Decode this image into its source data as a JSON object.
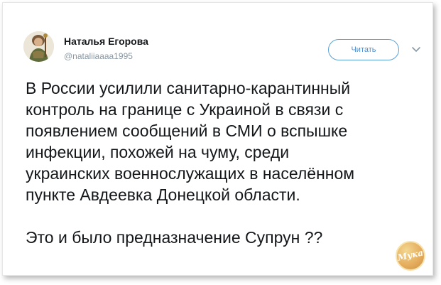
{
  "tweet": {
    "author": {
      "name": "Наталья Егорова",
      "handle": "@nataliiaaaa1995"
    },
    "follow_label": "Читать",
    "more_icon": "chevron-down-icon",
    "lines": [
      "В России усилили санитарно-карантинный",
      "контроль на границе с Украиной в связи с",
      "появлением сообщений в СМИ о вспышке",
      "инфекции, похожей на чуму, среди",
      "украинских военнослужащих в населённом",
      "пункте Авдеевка Донецкой области."
    ],
    "final_line": "Это и было предназначение Супрун ??"
  },
  "watermark": {
    "text": "Мука"
  },
  "colors": {
    "follow_border": "#5aa0d6",
    "follow_text": "#4a8fd0",
    "handle": "#8899a6",
    "text": "#14171a"
  }
}
